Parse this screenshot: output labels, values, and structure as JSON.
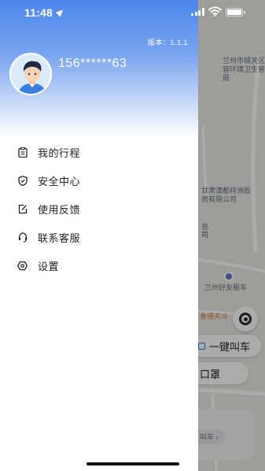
{
  "status_bar": {
    "time": "11:48"
  },
  "drawer": {
    "version": "版本：1.1.1",
    "phone": "156******63",
    "menu": [
      {
        "label": "我的行程",
        "icon": "trip-list-icon"
      },
      {
        "label": "安全中心",
        "icon": "shield-icon"
      },
      {
        "label": "使用反馈",
        "icon": "feedback-edit-icon"
      },
      {
        "label": "联系客服",
        "icon": "headset-icon"
      },
      {
        "label": "设置",
        "icon": "gear-icon"
      }
    ]
  },
  "map": {
    "labels": {
      "health": "兰州市城关区市容环境卫生管理局",
      "investment": "甘肃澳都祥洲投资有限公司",
      "hq": "总",
      "hq2": "司",
      "rental": "兰州好友租车",
      "restaurant": "食得天斗"
    },
    "quick_call": "一键叫车",
    "mask": "口罩",
    "bottom_chip": "叫车 ›"
  },
  "colors": {
    "accent": "#2d73f5",
    "header_blue": "#4c86ec"
  }
}
